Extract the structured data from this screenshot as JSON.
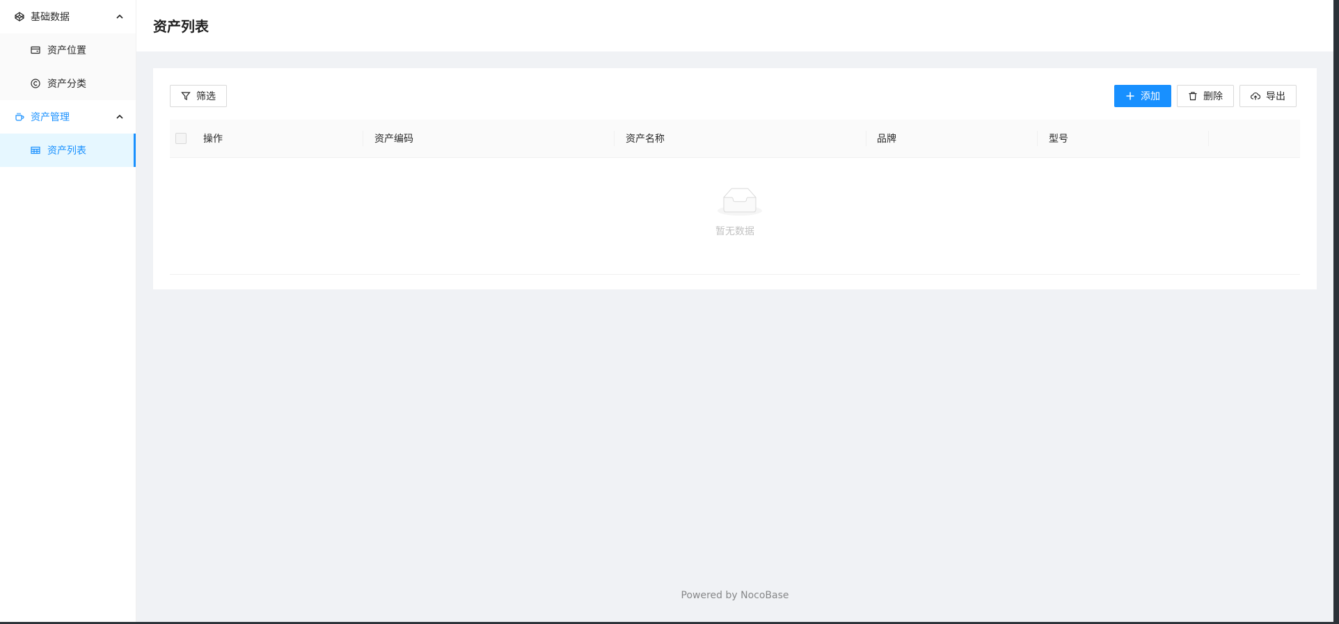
{
  "sidebar": {
    "groups": [
      {
        "title": "基础数据",
        "icon": "codepen-icon",
        "items": [
          {
            "label": "资产位置",
            "icon": "credit-card-icon"
          },
          {
            "label": "资产分类",
            "icon": "copyright-icon"
          }
        ]
      },
      {
        "title": "资产管理",
        "icon": "coffee-icon",
        "items": [
          {
            "label": "资产列表",
            "icon": "table-icon",
            "selected": true
          }
        ]
      }
    ]
  },
  "page": {
    "title": "资产列表"
  },
  "toolbar": {
    "filter_label": "筛选",
    "add_label": "添加",
    "delete_label": "删除",
    "export_label": "导出"
  },
  "table": {
    "columns": [
      "操作",
      "资产编码",
      "资产名称",
      "品牌",
      "型号"
    ],
    "empty_text": "暂无数据"
  },
  "footer": {
    "text": "Powered by NocoBase"
  },
  "colors": {
    "primary": "#1890ff",
    "background": "#f0f2f5",
    "selected_bg": "#e6f7ff"
  }
}
